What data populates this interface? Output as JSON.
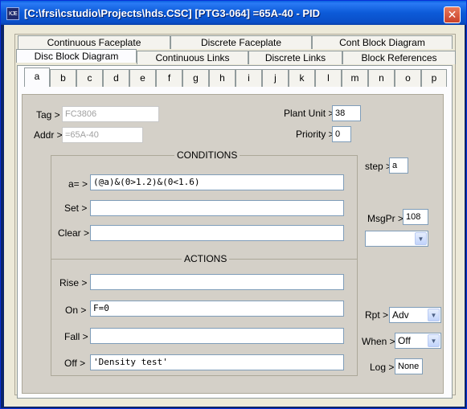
{
  "window": {
    "title": "[C:\\frsi\\cstudio\\Projects\\hds.CSC] [PTG3-064] =65A-40 - PID",
    "icon_text": "KJE",
    "close_glyph": "✕"
  },
  "tabs_row1": [
    "Continuous Faceplate",
    "Discrete Faceplate",
    "Cont Block Diagram"
  ],
  "tabs_row2": [
    "Disc Block Diagram",
    "Continuous Links",
    "Discrete Links",
    "Block References"
  ],
  "letter_tabs": [
    "a",
    "b",
    "c",
    "d",
    "e",
    "f",
    "g",
    "h",
    "i",
    "j",
    "k",
    "l",
    "m",
    "n",
    "o",
    "p"
  ],
  "form": {
    "tag_label": "Tag >",
    "tag_value": "FC3806",
    "addr_label": "Addr >",
    "addr_value": "=65A-40",
    "plant_unit_label": "Plant Unit >",
    "plant_unit_value": "38",
    "priority_label": "Priority >",
    "priority_value": "0",
    "conditions_title": "CONDITIONS",
    "a_label": "a= >",
    "a_value": "(@a)&(0>1.2)&(0<1.6)",
    "set_label": "Set >",
    "set_value": "",
    "clear_label": "Clear >",
    "clear_value": "",
    "actions_title": "ACTIONS",
    "rise_label": "Rise >",
    "rise_value": "",
    "on_label": "On >",
    "on_value": "F=0",
    "fall_label": "Fall >",
    "fall_value": "",
    "off_label": "Off >",
    "off_value": "'Density test'",
    "step_label": "step >",
    "step_value": "a",
    "msgpr_label": "MsgPr >",
    "msgpr_value": "108",
    "msgpr_select_value": "",
    "rpt_label": "Rpt >",
    "rpt_value": "Adv",
    "when_label": "When >",
    "when_value": "Off",
    "log_label": "Log >",
    "log_value": "None"
  }
}
